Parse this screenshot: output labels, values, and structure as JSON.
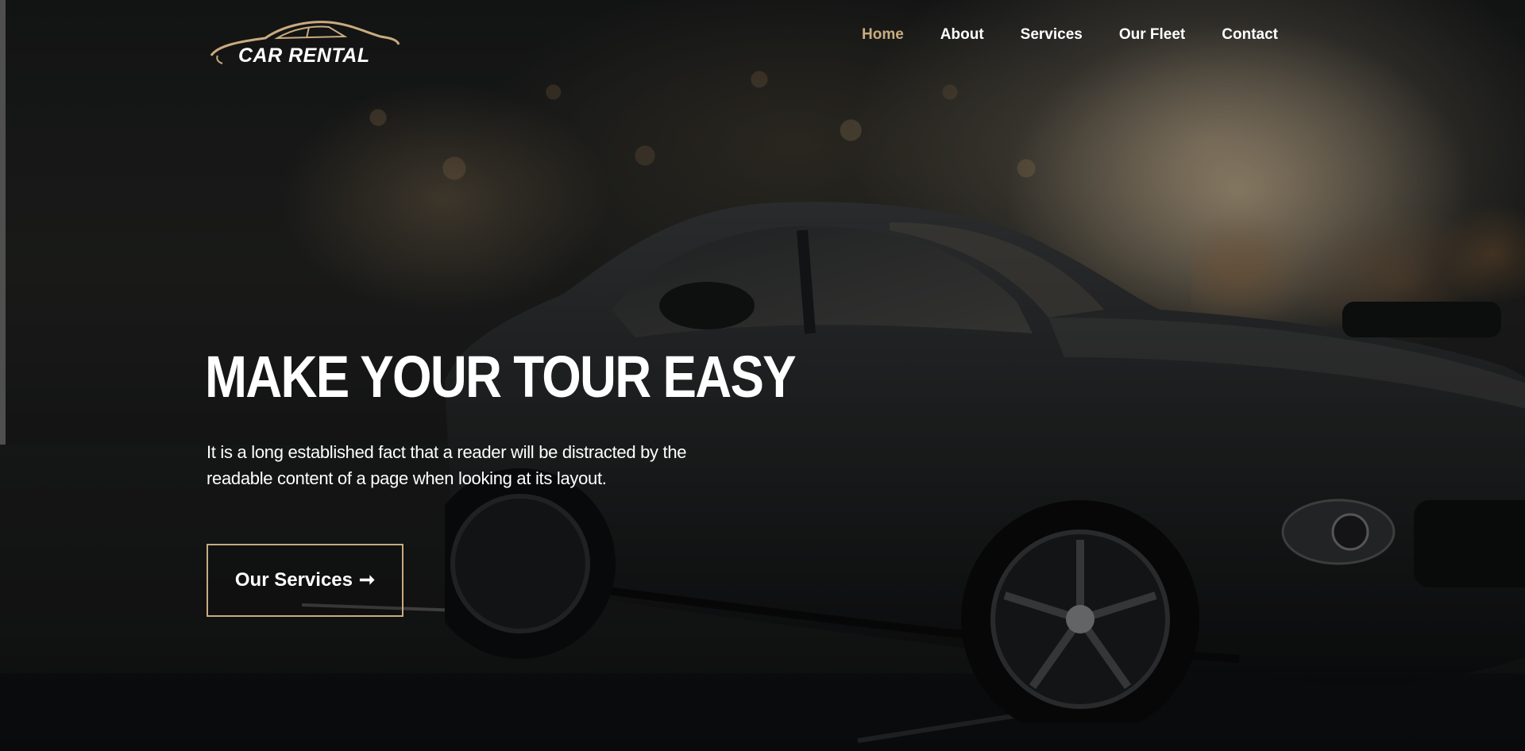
{
  "brand": {
    "logo_text": "CAR RENTAL",
    "logo_accent_color": "#c9ab7f"
  },
  "nav": {
    "items": [
      {
        "label": "Home",
        "active": true
      },
      {
        "label": "About",
        "active": false
      },
      {
        "label": "Services",
        "active": false
      },
      {
        "label": "Our Fleet",
        "active": false
      },
      {
        "label": "Contact",
        "active": false
      }
    ],
    "active_color": "#c9ab7f"
  },
  "hero": {
    "title": "MAKE YOUR TOUR EASY",
    "description": "It is a long established fact that a reader will be distracted by the readable content of a page when looking at its layout.",
    "cta_label": "Our Services",
    "cta_icon": "arrow-right-icon",
    "cta_border_color": "#c9ab7f"
  }
}
